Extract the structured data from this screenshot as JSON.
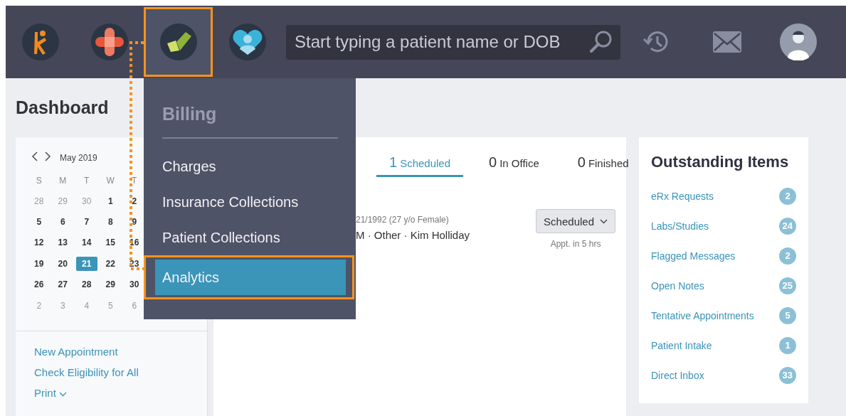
{
  "nav": {
    "apps": [
      {
        "selected": false
      },
      {
        "selected": false
      },
      {
        "selected": true
      },
      {
        "selected": false
      }
    ],
    "search": {
      "placeholder": "Start typing a patient name or DOB"
    }
  },
  "page_title": "Dashboard",
  "calendar": {
    "month": "May 2019",
    "weekdays": [
      "S",
      "M",
      "T",
      "W",
      "T"
    ],
    "weeks": [
      [
        {
          "label": "28",
          "outside": true,
          "selected": false
        },
        {
          "label": "29",
          "outside": true,
          "selected": false
        },
        {
          "label": "30",
          "outside": true,
          "selected": false
        },
        {
          "label": "1",
          "outside": false,
          "selected": false
        },
        {
          "label": "2",
          "outside": false,
          "selected": false
        }
      ],
      [
        {
          "label": "5",
          "outside": false,
          "selected": false
        },
        {
          "label": "6",
          "outside": false,
          "selected": false
        },
        {
          "label": "7",
          "outside": false,
          "selected": false
        },
        {
          "label": "8",
          "outside": false,
          "selected": false
        },
        {
          "label": "9",
          "outside": false,
          "selected": false
        }
      ],
      [
        {
          "label": "12",
          "outside": false,
          "selected": false
        },
        {
          "label": "13",
          "outside": false,
          "selected": false
        },
        {
          "label": "14",
          "outside": false,
          "selected": false
        },
        {
          "label": "15",
          "outside": false,
          "selected": false
        },
        {
          "label": "16",
          "outside": false,
          "selected": false
        }
      ],
      [
        {
          "label": "19",
          "outside": false,
          "selected": false
        },
        {
          "label": "20",
          "outside": false,
          "selected": false
        },
        {
          "label": "21",
          "outside": false,
          "selected": true
        },
        {
          "label": "22",
          "outside": false,
          "selected": false
        },
        {
          "label": "23",
          "outside": false,
          "selected": false
        }
      ],
      [
        {
          "label": "26",
          "outside": false,
          "selected": false
        },
        {
          "label": "27",
          "outside": false,
          "selected": false
        },
        {
          "label": "28",
          "outside": false,
          "selected": false
        },
        {
          "label": "29",
          "outside": false,
          "selected": false
        },
        {
          "label": "30",
          "outside": false,
          "selected": false
        }
      ],
      [
        {
          "label": "2",
          "outside": true,
          "selected": false
        },
        {
          "label": "3",
          "outside": true,
          "selected": false
        },
        {
          "label": "4",
          "outside": true,
          "selected": false
        },
        {
          "label": "5",
          "outside": true,
          "selected": false
        },
        {
          "label": "6",
          "outside": true,
          "selected": false
        }
      ]
    ]
  },
  "calendar_links": [
    {
      "label": "New Appointment",
      "kind": "link"
    },
    {
      "label": "Check Eligibility for All",
      "kind": "link"
    },
    {
      "label": "Print",
      "kind": "dropdown"
    }
  ],
  "appointments": {
    "tabs": [
      {
        "count": "1",
        "label": "Scheduled",
        "selected": true
      },
      {
        "count": "0",
        "label": "In Office",
        "selected": false
      },
      {
        "count": "0",
        "label": "Finished",
        "selected": false
      }
    ],
    "rows": [
      {
        "details": "21/1992 (27 y/o Female)",
        "summary": "M · Other · Kim Holliday",
        "status": "Scheduled",
        "time": "Appt. in 5 hrs"
      }
    ]
  },
  "outstanding": {
    "title": "Outstanding Items",
    "items": [
      {
        "label": "eRx Requests",
        "count": "2"
      },
      {
        "label": "Labs/Studies",
        "count": "24"
      },
      {
        "label": "Flagged Messages",
        "count": "2"
      },
      {
        "label": "Open Notes",
        "count": "25"
      },
      {
        "label": "Tentative Appointments",
        "count": "5"
      },
      {
        "label": "Patient Intake",
        "count": "1"
      },
      {
        "label": "Direct Inbox",
        "count": "33"
      }
    ]
  },
  "billing_menu": {
    "title": "Billing",
    "items": [
      {
        "label": "Charges",
        "selected": false
      },
      {
        "label": "Insurance Collections",
        "selected": false
      },
      {
        "label": "Patient Collections",
        "selected": false
      },
      {
        "label": "Analytics",
        "selected": true
      }
    ]
  }
}
